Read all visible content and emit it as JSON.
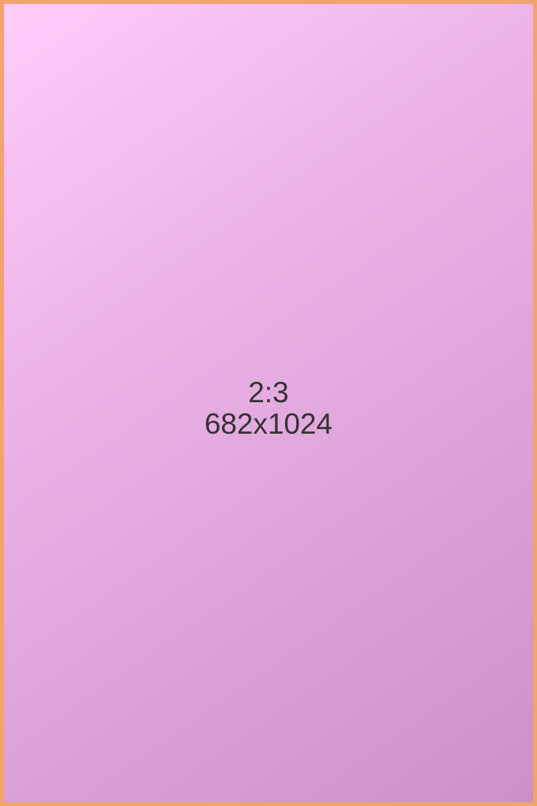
{
  "placeholder": {
    "ratio_text": "2:3",
    "size_text": "682x1024"
  },
  "colors": {
    "border": "#f3a46c",
    "gradient_start": "#ffccfa",
    "gradient_end": "#cc90c8",
    "text": "#333333"
  }
}
